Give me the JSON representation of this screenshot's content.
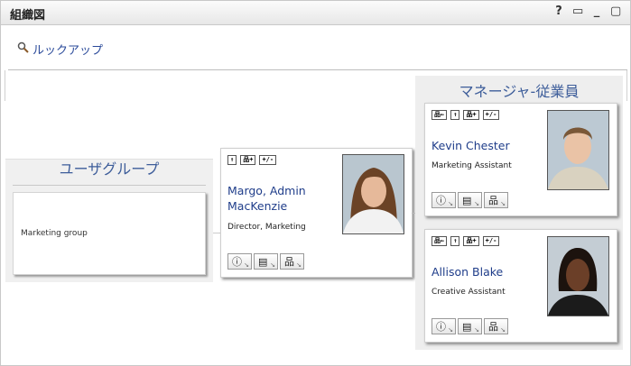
{
  "window": {
    "title": "組織図",
    "icons": [
      "help-icon",
      "print-icon",
      "minimize-icon",
      "maximize-icon"
    ],
    "icon_glyphs": {
      "help": "?",
      "print": "▭",
      "minimize": "_",
      "maximize": "▢"
    }
  },
  "lookup": {
    "label": "ルックアップ",
    "icon": "magnifier-icon"
  },
  "group_panel": {
    "header": "ユーザグループ",
    "item": "Marketing group"
  },
  "center_card": {
    "name_line1": "Margo, Admin",
    "name_line2": "MacKenzie",
    "title": "Director, Marketing",
    "buttons": [
      "↑",
      "品+",
      "+/-"
    ]
  },
  "manager_panel": {
    "header": "マネージャ-従業員",
    "employees": [
      {
        "name": "Kevin Chester",
        "title": "Marketing Assistant",
        "buttons": [
          "品←",
          "↑",
          "品+",
          "+/-"
        ]
      },
      {
        "name": "Allison Blake",
        "title": "Creative Assistant",
        "buttons": [
          "品←",
          "↑",
          "品+",
          "+/-"
        ]
      }
    ]
  },
  "action_buttons": [
    "info-icon",
    "email-icon",
    "org-chart-icon"
  ],
  "action_glyphs": {
    "info": "ⓘ",
    "email": "▤",
    "org": "品",
    "corner": "↘"
  },
  "colors": {
    "link": "#1f3d8a",
    "header": "#3d5d9a",
    "panel_bg": "#eeeeee"
  }
}
